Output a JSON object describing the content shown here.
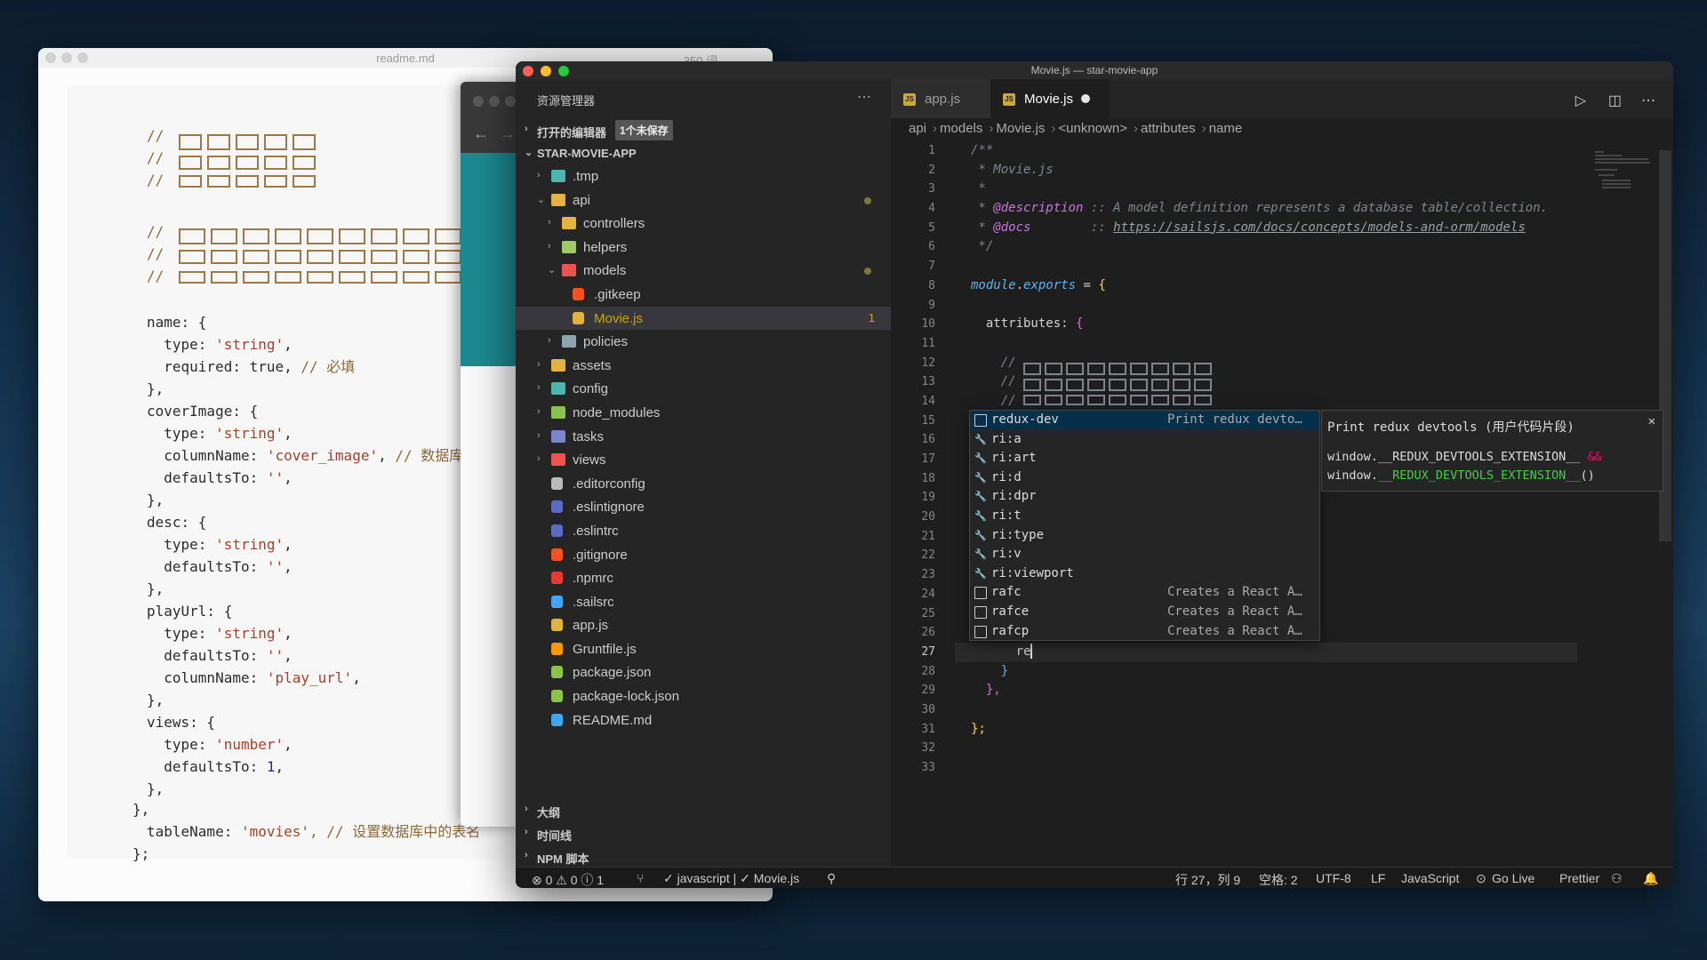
{
  "readme": {
    "title": "readme.md",
    "count": "350 词",
    "code": {
      "name_block": [
        "name: {",
        "  type: ",
        "'string'",
        ",",
        "  required: ",
        "true",
        ", // 必填",
        "},"
      ],
      "lines": [
        {
          "t": "name: {"
        },
        {
          "t": "  type: ",
          "s": "'string'",
          "e": ","
        },
        {
          "t": "  required: true, ",
          "c": "// 必填"
        },
        {
          "t": "},"
        },
        {
          "t": "coverImage: {"
        },
        {
          "t": "  type: ",
          "s": "'string'",
          "e": ","
        },
        {
          "t": "  columnName: ",
          "s": "'cover_image'",
          "e": ", ",
          "c": "// 数据库中存"
        },
        {
          "t": "  defaultsTo: ",
          "s": "''",
          "e": ","
        },
        {
          "t": "},"
        },
        {
          "t": "desc: {"
        },
        {
          "t": "  type: ",
          "s": "'string'",
          "e": ","
        },
        {
          "t": "  defaultsTo: ",
          "s": "''",
          "e": ","
        },
        {
          "t": "},"
        },
        {
          "t": "playUrl: {"
        },
        {
          "t": "  type: ",
          "s": "'string'",
          "e": ","
        },
        {
          "t": "  defaultsTo: ",
          "s": "''",
          "e": ","
        },
        {
          "t": "  columnName: ",
          "s": "'play_url'",
          "e": ","
        },
        {
          "t": "},"
        },
        {
          "t": "views: {"
        },
        {
          "t": "  type: ",
          "s": "'number'",
          "e": ","
        },
        {
          "t": "  defaultsTo: ",
          "n": "1",
          "e": ","
        },
        {
          "t": "},"
        }
      ],
      "closing1": "},",
      "table_key": "tableName: ",
      "table_val": "'movies'",
      "table_comment": ", // 设置数据库中的表名",
      "closing2": "};"
    }
  },
  "vscode": {
    "window_title": "Movie.js — star-movie-app",
    "explorer_title": "资源管理器",
    "open_editors": "打开的编辑器",
    "unsaved_badge": "1个未保存",
    "project": "STAR-MOVIE-APP",
    "tree": [
      {
        "name": ".tmp",
        "depth": 0,
        "folder": true,
        "open": false,
        "color": "#4db6ac"
      },
      {
        "name": "api",
        "depth": 0,
        "folder": true,
        "open": true,
        "color": "#e3b341",
        "dot": true
      },
      {
        "name": "controllers",
        "depth": 1,
        "folder": true,
        "open": false,
        "color": "#e3b341"
      },
      {
        "name": "helpers",
        "depth": 1,
        "folder": true,
        "open": false,
        "color": "#9ccc65"
      },
      {
        "name": "models",
        "depth": 1,
        "folder": true,
        "open": true,
        "color": "#ef5350",
        "dot": true
      },
      {
        "name": ".gitkeep",
        "depth": 2,
        "folder": false,
        "color": "#f4511e"
      },
      {
        "name": "Movie.js",
        "depth": 2,
        "folder": false,
        "color": "#e3b341",
        "selected": true,
        "badge": "1"
      },
      {
        "name": "policies",
        "depth": 1,
        "folder": true,
        "open": false,
        "color": "#90a4ae"
      },
      {
        "name": "assets",
        "depth": 0,
        "folder": true,
        "open": false,
        "color": "#e3b341"
      },
      {
        "name": "config",
        "depth": 0,
        "folder": true,
        "open": false,
        "color": "#4db6ac"
      },
      {
        "name": "node_modules",
        "depth": 0,
        "folder": true,
        "open": false,
        "color": "#8bc34a"
      },
      {
        "name": "tasks",
        "depth": 0,
        "folder": true,
        "open": false,
        "color": "#7986cb"
      },
      {
        "name": "views",
        "depth": 0,
        "folder": true,
        "open": false,
        "color": "#ef5350"
      },
      {
        "name": ".editorconfig",
        "depth": 0,
        "folder": false,
        "color": "#bbbbbb"
      },
      {
        "name": ".eslintignore",
        "depth": 0,
        "folder": false,
        "color": "#5c6bc0"
      },
      {
        "name": ".eslintrc",
        "depth": 0,
        "folder": false,
        "color": "#5c6bc0"
      },
      {
        "name": ".gitignore",
        "depth": 0,
        "folder": false,
        "color": "#f4511e"
      },
      {
        "name": ".npmrc",
        "depth": 0,
        "folder": false,
        "color": "#e53935"
      },
      {
        "name": ".sailsrc",
        "depth": 0,
        "folder": false,
        "color": "#42a5f5"
      },
      {
        "name": "app.js",
        "depth": 0,
        "folder": false,
        "color": "#e3b341"
      },
      {
        "name": "Gruntfile.js",
        "depth": 0,
        "folder": false,
        "color": "#ff9800"
      },
      {
        "name": "package.json",
        "depth": 0,
        "folder": false,
        "color": "#8bc34a"
      },
      {
        "name": "package-lock.json",
        "depth": 0,
        "folder": false,
        "color": "#8bc34a"
      },
      {
        "name": "README.md",
        "depth": 0,
        "folder": false,
        "color": "#42a5f5"
      }
    ],
    "outline_sections": [
      "大纲",
      "时间线",
      "NPM 脚本"
    ],
    "tabs": [
      {
        "label": "app.js",
        "active": false
      },
      {
        "label": "Movie.js",
        "active": true
      }
    ],
    "breadcrumb": [
      "api",
      "models",
      "Movie.js",
      "<unknown>",
      "attributes",
      "name"
    ],
    "line_numbers": [
      1,
      2,
      3,
      4,
      5,
      6,
      7,
      8,
      9,
      10,
      11,
      12,
      13,
      14,
      15,
      16,
      17,
      18,
      19,
      20,
      21,
      22,
      23,
      24,
      25,
      26,
      27,
      28,
      29,
      30,
      31,
      32,
      33
    ],
    "code": {
      "l1": "/**",
      "l2": " * Movie.js",
      "l3": " *",
      "l4_tag": "@description",
      "l4_text": " :: A model definition represents a database table/collection.",
      "l5_tag": "@docs",
      "l5_sep": "        :: ",
      "l5_link": "https://sailsjs.com/docs/concepts/models-and-orm/models",
      "l6": " */",
      "l8_a": "module",
      "l8_b": ".",
      "l8_c": "exports",
      "l8_d": " = ",
      "l8_e": "{",
      "l10_a": "  attributes: ",
      "l10_b": "{",
      "l12": "    //",
      "l13": "    //",
      "l14": "    //",
      "l27": "      re",
      "l28": "    }",
      "l29": "  },",
      "l31": "};"
    },
    "suggestions": [
      {
        "label": "redux-dev",
        "detail": "Print redux devto…",
        "kind": "snippet"
      },
      {
        "label": "ri:a",
        "detail": "",
        "kind": "wrench"
      },
      {
        "label": "ri:art",
        "detail": "",
        "kind": "wrench"
      },
      {
        "label": "ri:d",
        "detail": "",
        "kind": "wrench"
      },
      {
        "label": "ri:dpr",
        "detail": "",
        "kind": "wrench"
      },
      {
        "label": "ri:t",
        "detail": "",
        "kind": "wrench"
      },
      {
        "label": "ri:type",
        "detail": "",
        "kind": "wrench"
      },
      {
        "label": "ri:v",
        "detail": "",
        "kind": "wrench"
      },
      {
        "label": "ri:viewport",
        "detail": "",
        "kind": "wrench"
      },
      {
        "label": "rafc",
        "detail": "Creates a React A…",
        "kind": "snippet"
      },
      {
        "label": "rafce",
        "detail": "Creates a React A…",
        "kind": "snippet"
      },
      {
        "label": "rafcp",
        "detail": "Creates a React A…",
        "kind": "snippet"
      }
    ],
    "detail": {
      "title": "Print redux devtools (用户代码片段)",
      "line1": "window.__REDUX_DEVTOOLS_EXTENSION__ ",
      "line1_tail": "&&",
      "line2_a": "window.",
      "line2_b": "__REDUX_DEVTOOLS_EXTENSION__",
      "line2_c": "()"
    },
    "status": {
      "problems": "⊗ 0 ⚠ 0 ⓘ 1",
      "lint": "✓ javascript | ✓ Movie.js",
      "position": "行 27，列 9",
      "spaces": "空格: 2",
      "encoding": "UTF-8",
      "eol": "LF",
      "language": "JavaScript",
      "golive": "Go Live",
      "prettier": "Prettier"
    }
  }
}
